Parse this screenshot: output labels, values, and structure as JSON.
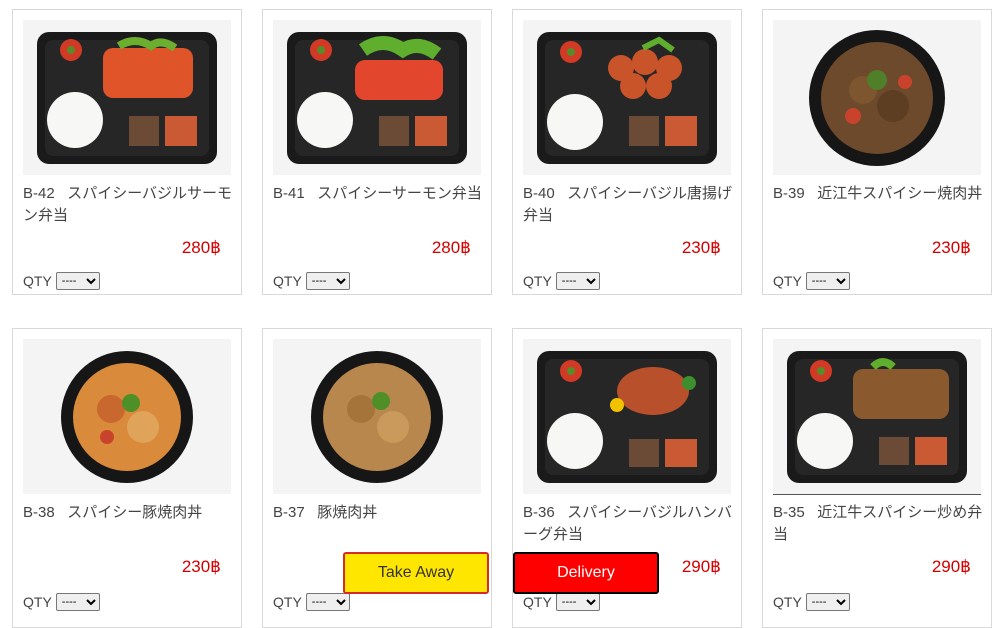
{
  "qty_label": "QTY",
  "qty_placeholder": "----",
  "products": [
    {
      "code": "B-42",
      "name": "スパイシーバジルサーモン弁当",
      "price": "280฿",
      "type": "bento-salmon"
    },
    {
      "code": "B-41",
      "name": "スパイシーサーモン弁当",
      "price": "280฿",
      "type": "bento-salmon2"
    },
    {
      "code": "B-40",
      "name": "スパイシーバジル唐揚げ弁当",
      "price": "230฿",
      "type": "bento-karaage"
    },
    {
      "code": "B-39",
      "name": "近江牛スパイシー焼肉丼",
      "price": "230฿",
      "type": "bowl-beef"
    },
    {
      "code": "B-38",
      "name": "スパイシー豚焼肉丼",
      "price": "230฿",
      "type": "bowl-pork"
    },
    {
      "code": "B-37",
      "name": "豚焼肉丼",
      "price": "",
      "type": "bowl-pork2"
    },
    {
      "code": "B-36",
      "name": "スパイシーバジルハンバーグ弁当",
      "price": "290฿",
      "type": "bento-hamburg"
    },
    {
      "code": "B-35",
      "name": "近江牛スパイシー炒め弁当",
      "price": "290฿",
      "type": "bento-beef"
    }
  ],
  "buttons": {
    "take_away": "Take Away",
    "delivery": "Delivery"
  },
  "colors": {
    "price": "#d40000",
    "take_away_bg": "#ffe600",
    "delivery_bg": "#ff0000"
  }
}
